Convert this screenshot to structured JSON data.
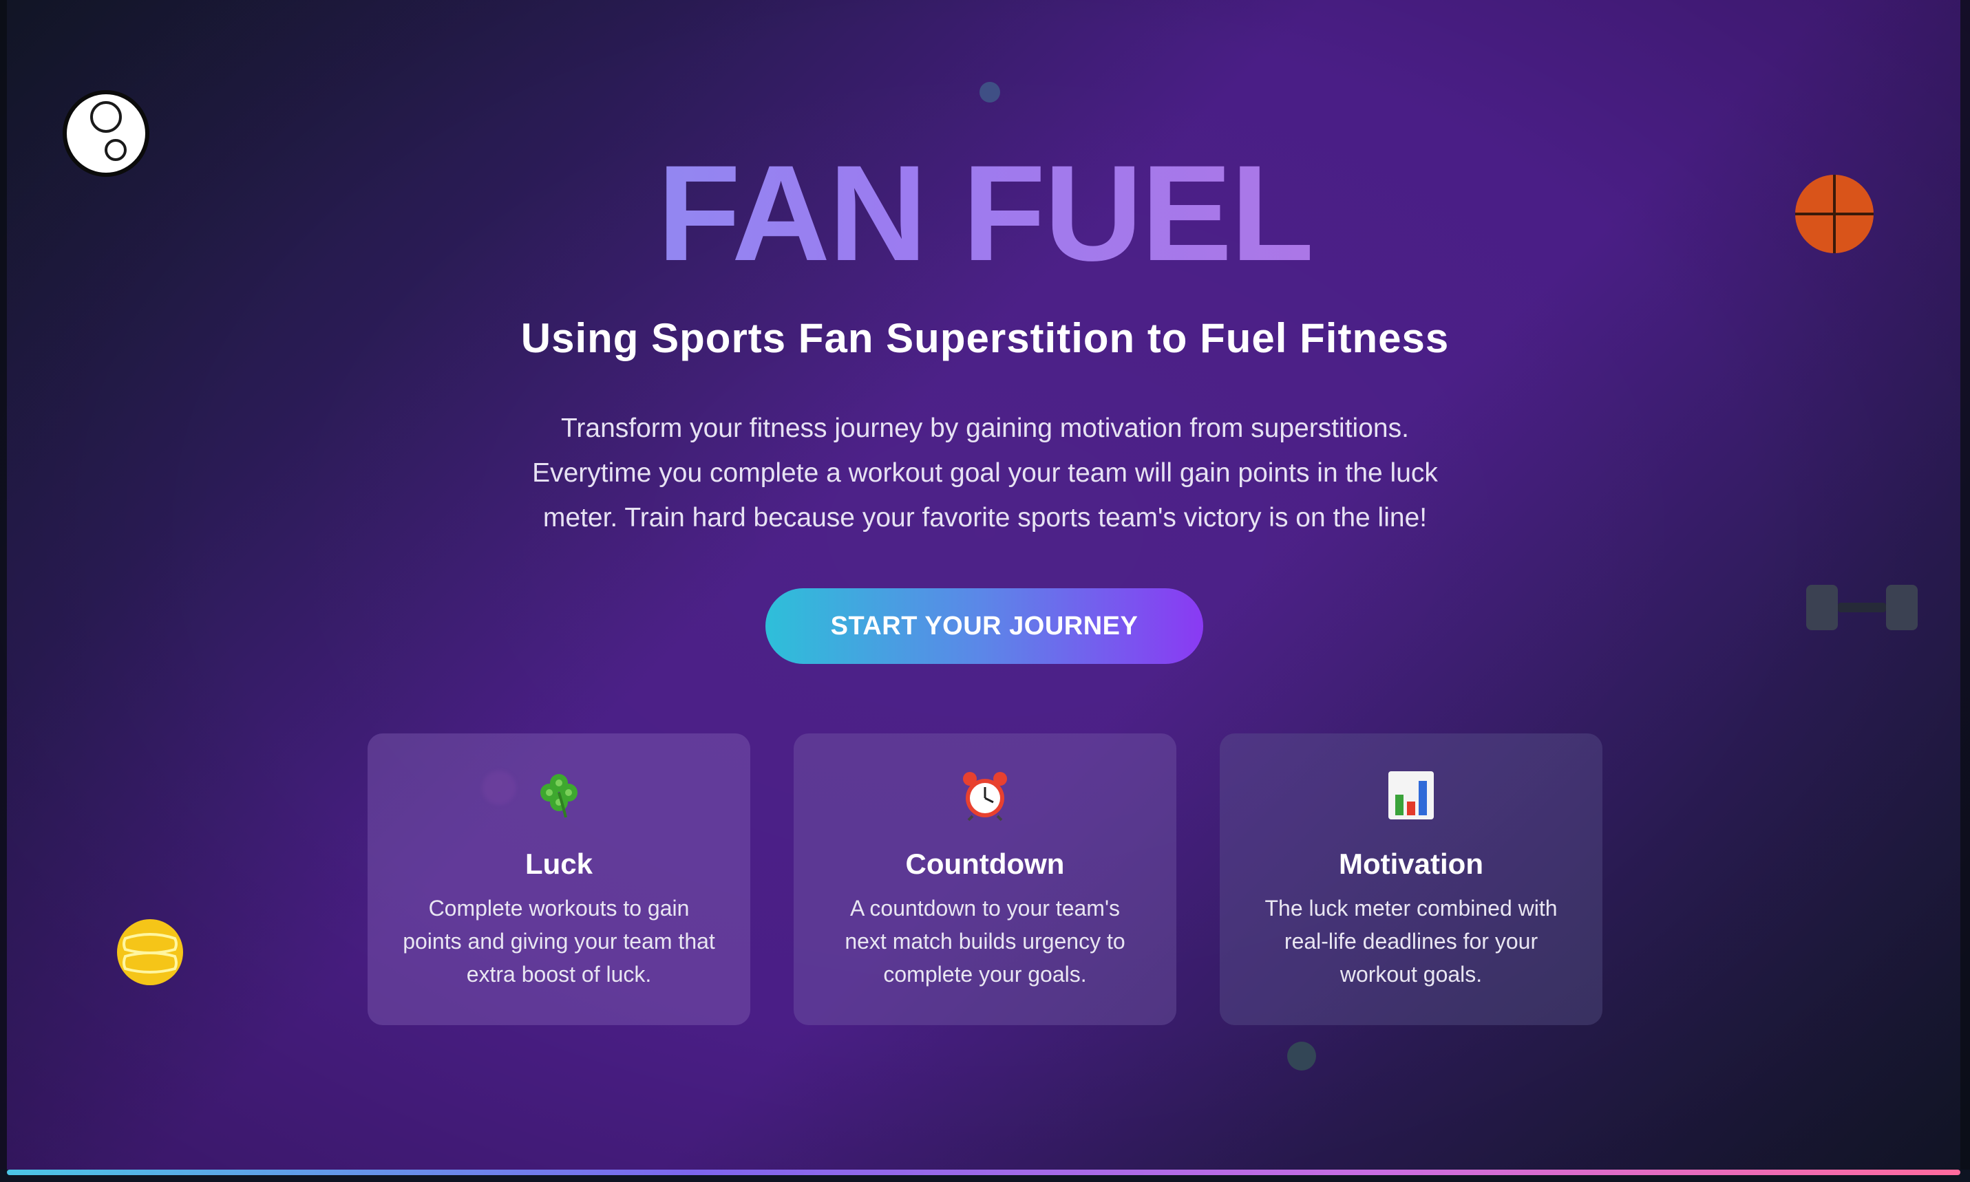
{
  "hero": {
    "title": "FAN FUEL",
    "subtitle": "Using Sports Fan Superstition to Fuel Fitness",
    "description_lines": [
      "Transform your fitness journey by gaining motivation from superstitions.",
      "Everytime you complete a workout goal your team will gain points in the luck",
      "meter. Train hard because your favorite sports team's victory is on the line!"
    ],
    "cta_label": "START YOUR JOURNEY"
  },
  "features": [
    {
      "icon": "four-leaf-clover-icon",
      "glyph": "🍀",
      "title": "Luck",
      "text": "Complete workouts to gain points and giving your team that extra boost of luck."
    },
    {
      "icon": "alarm-clock-icon",
      "glyph": "⏰",
      "title": "Countdown",
      "text": "A countdown to your team's next match builds urgency to complete your goals."
    },
    {
      "icon": "bar-chart-icon",
      "glyph": "📊",
      "title": "Motivation",
      "text": "The luck meter combined with real-life deadlines for your workout goals."
    }
  ],
  "decorations": {
    "icons": [
      "ring-icon",
      "basketball-icon",
      "dumbbell-icon",
      "tennis-ball-icon"
    ]
  },
  "colors": {
    "background_dark": "#151a2e",
    "background_purple": "#4a1e86",
    "title_gradient_start": "#7aa7f5",
    "title_gradient_end": "#c56fd8",
    "cta_gradient_start": "#2ebfd9",
    "cta_gradient_end": "#8a3af3",
    "basketball": "#d9541a",
    "tennis_ball": "#f5c518"
  }
}
